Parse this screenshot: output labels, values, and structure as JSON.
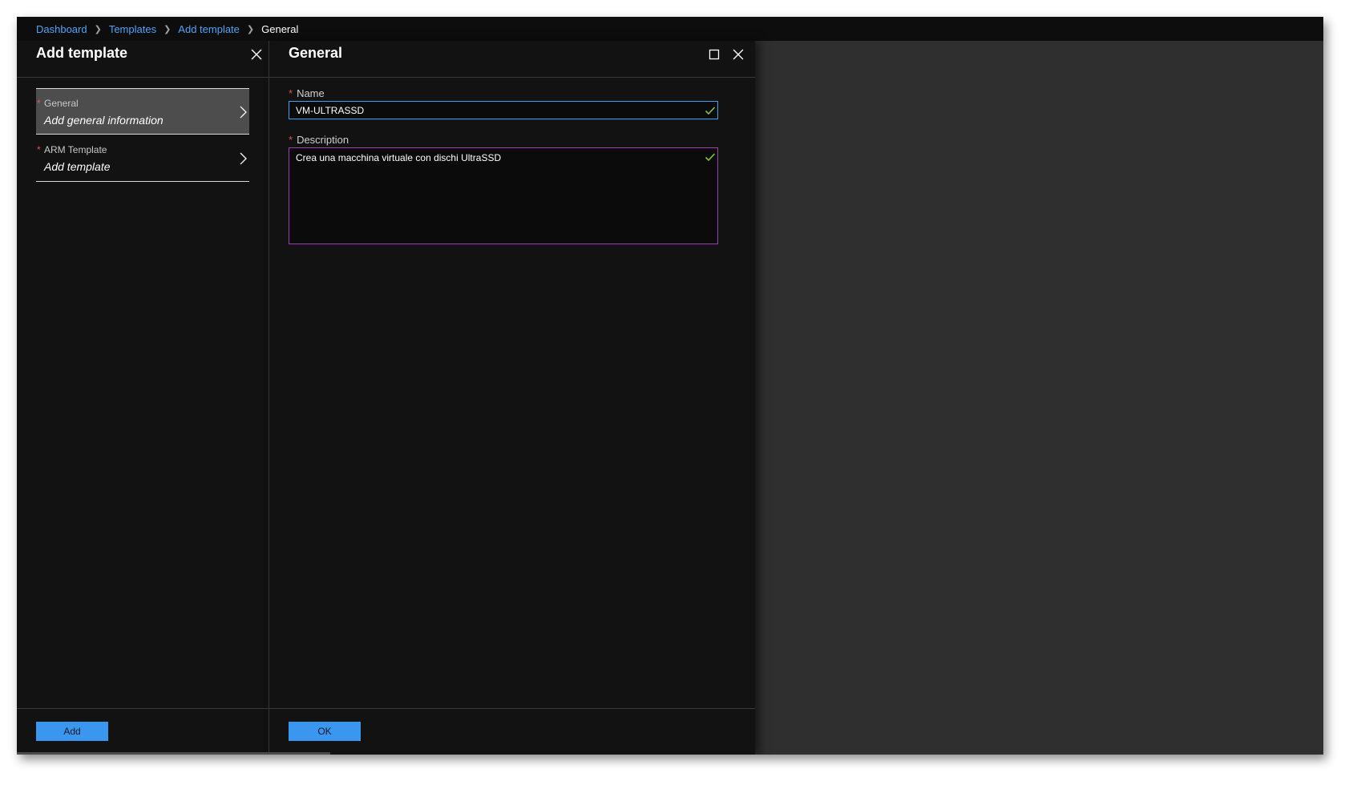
{
  "breadcrumb": {
    "items": [
      {
        "label": "Dashboard"
      },
      {
        "label": "Templates"
      },
      {
        "label": "Add template"
      }
    ],
    "current": "General"
  },
  "left_blade": {
    "title": "Add template",
    "steps": [
      {
        "name": "General",
        "description": "Add general information",
        "required": "*"
      },
      {
        "name": "ARM Template",
        "description": "Add template",
        "required": "*"
      }
    ],
    "add_label": "Add"
  },
  "right_blade": {
    "title": "General",
    "name_field": {
      "label": "Name",
      "value": "VM-ULTRASSD",
      "required": "*"
    },
    "description_field": {
      "label": "Description",
      "value": "Crea una macchina virtuale con dischi UltraSSD",
      "required": "*"
    },
    "ok_label": "OK"
  },
  "colors": {
    "accent_link": "#4fa3f7",
    "primary_button": "#3a96ef",
    "valid_check": "#7dc243",
    "required_star": "#e05050",
    "focus_border": "#3aa0f0"
  },
  "icons": [
    "chevron-right-icon",
    "close-icon",
    "maximize-icon",
    "checkmark-icon"
  ]
}
